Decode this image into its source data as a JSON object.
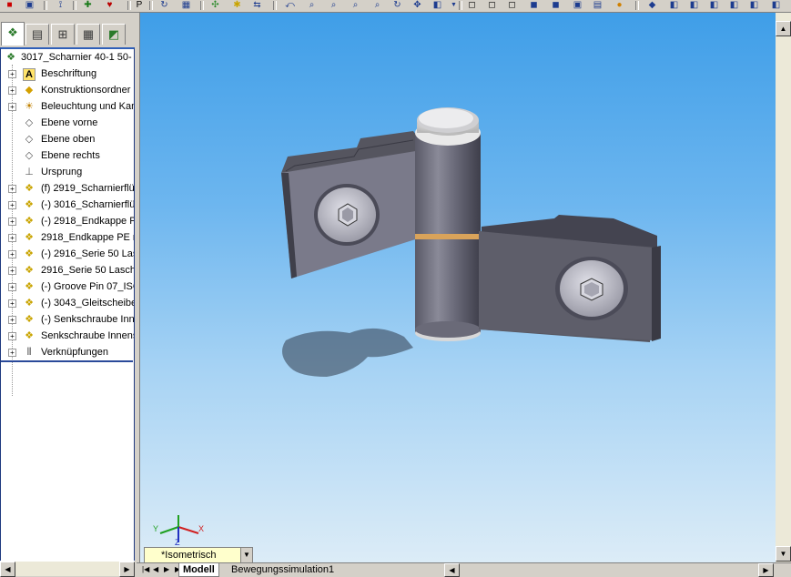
{
  "tree": {
    "root": "3017_Scharnier 40-1 50-",
    "items": [
      {
        "label": "Beschriftung",
        "icon": "annotation-icon",
        "expandable": true
      },
      {
        "label": "Konstruktionsordner",
        "icon": "design-binder-icon",
        "expandable": true
      },
      {
        "label": "Beleuchtung und Kam",
        "icon": "lights-camera-icon",
        "expandable": true
      },
      {
        "label": "Ebene vorne",
        "icon": "plane-icon",
        "expandable": false
      },
      {
        "label": "Ebene oben",
        "icon": "plane-icon",
        "expandable": false
      },
      {
        "label": "Ebene rechts",
        "icon": "plane-icon",
        "expandable": false
      },
      {
        "label": "Ursprung",
        "icon": "origin-icon",
        "expandable": false
      },
      {
        "label": "(f) 2919_Scharnierflü",
        "icon": "part-icon",
        "expandable": true
      },
      {
        "label": "(-) 3016_Scharnierflü",
        "icon": "part-icon",
        "expandable": true
      },
      {
        "label": "(-) 2918_Endkappe P",
        "icon": "part-icon",
        "expandable": true
      },
      {
        "label": "2918_Endkappe PE  n",
        "icon": "part-icon",
        "expandable": true
      },
      {
        "label": "(-) 2916_Serie 50 Las",
        "icon": "part-icon",
        "expandable": true
      },
      {
        "label": "2916_Serie 50 Lasche",
        "icon": "part-icon",
        "expandable": true
      },
      {
        "label": "(-) Groove Pin 07_ISO",
        "icon": "part-icon",
        "expandable": true
      },
      {
        "label": "(-) 3043_Gleitscheibe",
        "icon": "part-icon",
        "expandable": true
      },
      {
        "label": "(-) Senkschraube Inn",
        "icon": "part-icon",
        "expandable": true
      },
      {
        "label": "Senkschraube Innens",
        "icon": "part-icon",
        "expandable": true
      },
      {
        "label": "Verknüpfungen",
        "icon": "mates-icon",
        "expandable": true
      }
    ]
  },
  "view": {
    "orientation": "*Isometrisch",
    "triad_labels": {
      "x": "X",
      "y": "Y",
      "z": "Z"
    }
  },
  "bottom_tabs": [
    {
      "label": "Modell",
      "active": true
    },
    {
      "label": "Bewegungssimulation1",
      "active": false
    }
  ],
  "toolbar": {
    "partial_label": "P"
  },
  "colors": {
    "viewport_top": "#3f9ee8",
    "viewport_bottom": "#dcecf7",
    "tree_border": "#2f5fb8"
  }
}
